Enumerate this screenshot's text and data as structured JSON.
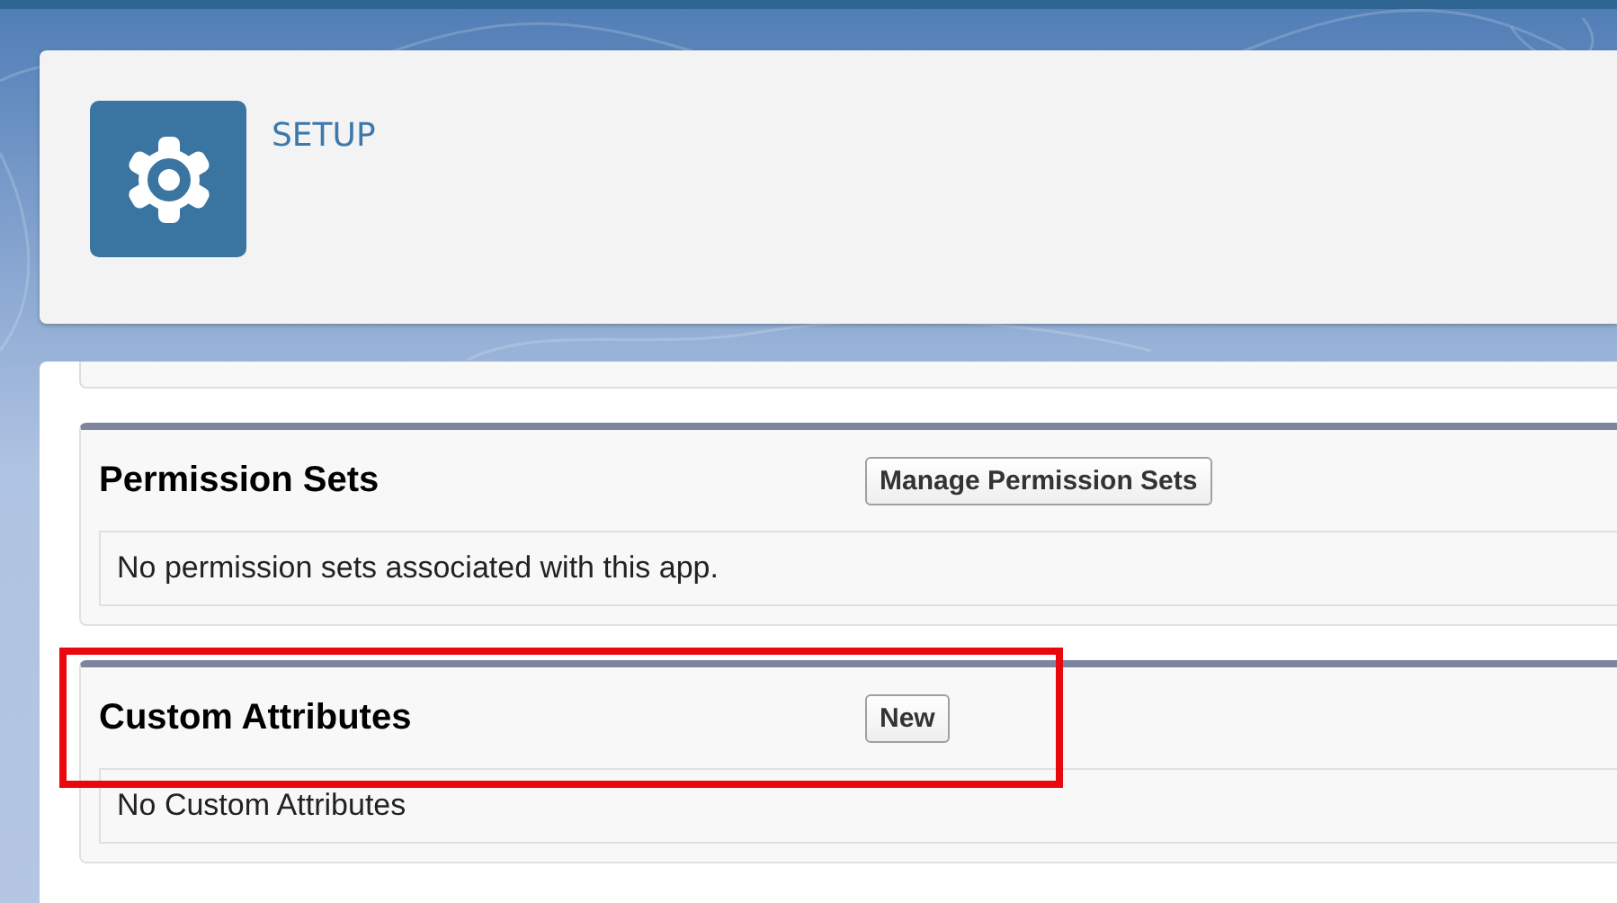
{
  "header": {
    "title": "SETUP"
  },
  "sections": [
    {
      "title": "Permission Sets",
      "button": "Manage Permission Sets",
      "message": "No permission sets associated with this app.",
      "highlighted": false
    },
    {
      "title": "Custom Attributes",
      "button": "New",
      "message": "No Custom Attributes",
      "highlighted": true
    }
  ]
}
